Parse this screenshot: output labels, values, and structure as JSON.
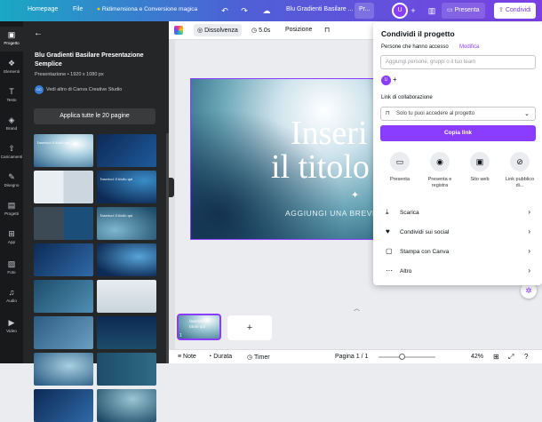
{
  "topbar": {
    "home": "Homepage",
    "file": "File",
    "magic": "Ridimensiona e Conversione magica",
    "doc_title": "Blu Gradienti Basilare ...",
    "pro_label": "Pr...",
    "avatar": "U",
    "present": "Presenta",
    "share": "Condividi"
  },
  "rail": [
    {
      "label": "Progetto",
      "icon": "▣"
    },
    {
      "label": "Elementi",
      "icon": "❖"
    },
    {
      "label": "Testo",
      "icon": "T"
    },
    {
      "label": "Brand",
      "icon": "◈"
    },
    {
      "label": "Caricamenti",
      "icon": "⇧"
    },
    {
      "label": "Disegno",
      "icon": "✎"
    },
    {
      "label": "Progetti",
      "icon": "▤"
    },
    {
      "label": "App",
      "icon": "⊞"
    },
    {
      "label": "Foto",
      "icon": "▨"
    },
    {
      "label": "Audio",
      "icon": "♫"
    },
    {
      "label": "Video",
      "icon": "▶"
    }
  ],
  "panel": {
    "title": "Blu Gradienti Basilare Presentazione Semplice",
    "meta": "Presentazione • 1920 x 1080 px",
    "author": "Vedi altro di Canva Creative Studio",
    "author_badge": "CC",
    "apply": "Applica tutte le 20 pagine",
    "thumbs": [
      "Inserisci il titolo qui",
      "",
      "",
      "Inserisci il titolo qui",
      "",
      "Inserisci il titolo qui",
      "",
      "",
      "",
      "",
      "",
      "",
      "",
      "",
      "",
      ""
    ]
  },
  "toolbar": {
    "dissolve": "Dissolvenza",
    "duration": "5.0s",
    "position": "Posizione"
  },
  "slide": {
    "title_line1": "Inseri",
    "title_line2": "il titolo",
    "subtitle": "AGGIUNGI UNA BREVE DE"
  },
  "filmstrip": {
    "thumb_text": "Inserisci il titolo qui",
    "page_num": "1",
    "add": "+"
  },
  "bottombar": {
    "notes": "Note",
    "duration": "Durata",
    "timer": "Timer",
    "page": "Pagina 1 / 1",
    "zoom": "42%",
    "zoom_level": 0.42
  },
  "share": {
    "title": "Condividi il progetto",
    "access_label": "Persone che hanno accesso",
    "modify": "Modifica",
    "input_placeholder": "Aggiungi persone, gruppi o il tuo team",
    "avatar": "U",
    "collab_label": "Link di collaborazione",
    "access_select": "Solo tu puoi accedere al progetto",
    "copy": "Copia link",
    "options": [
      {
        "label": "Presenta",
        "icon": "present-icon"
      },
      {
        "label": "Presenta e registra",
        "icon": "record-icon"
      },
      {
        "label": "Sito web",
        "icon": "website-icon"
      },
      {
        "label": "Link pubblico di...",
        "icon": "public-link-icon"
      }
    ],
    "list": [
      {
        "label": "Scarica",
        "icon": "download-icon"
      },
      {
        "label": "Condividi sui social",
        "icon": "social-icon"
      },
      {
        "label": "Stampa con Canva",
        "icon": "print-icon"
      },
      {
        "label": "Altro",
        "icon": "more-icon"
      }
    ]
  },
  "colors": {
    "accent": "#8b3dff",
    "topbar_start": "#1aa8c4",
    "topbar_end": "#7b3fe4"
  }
}
